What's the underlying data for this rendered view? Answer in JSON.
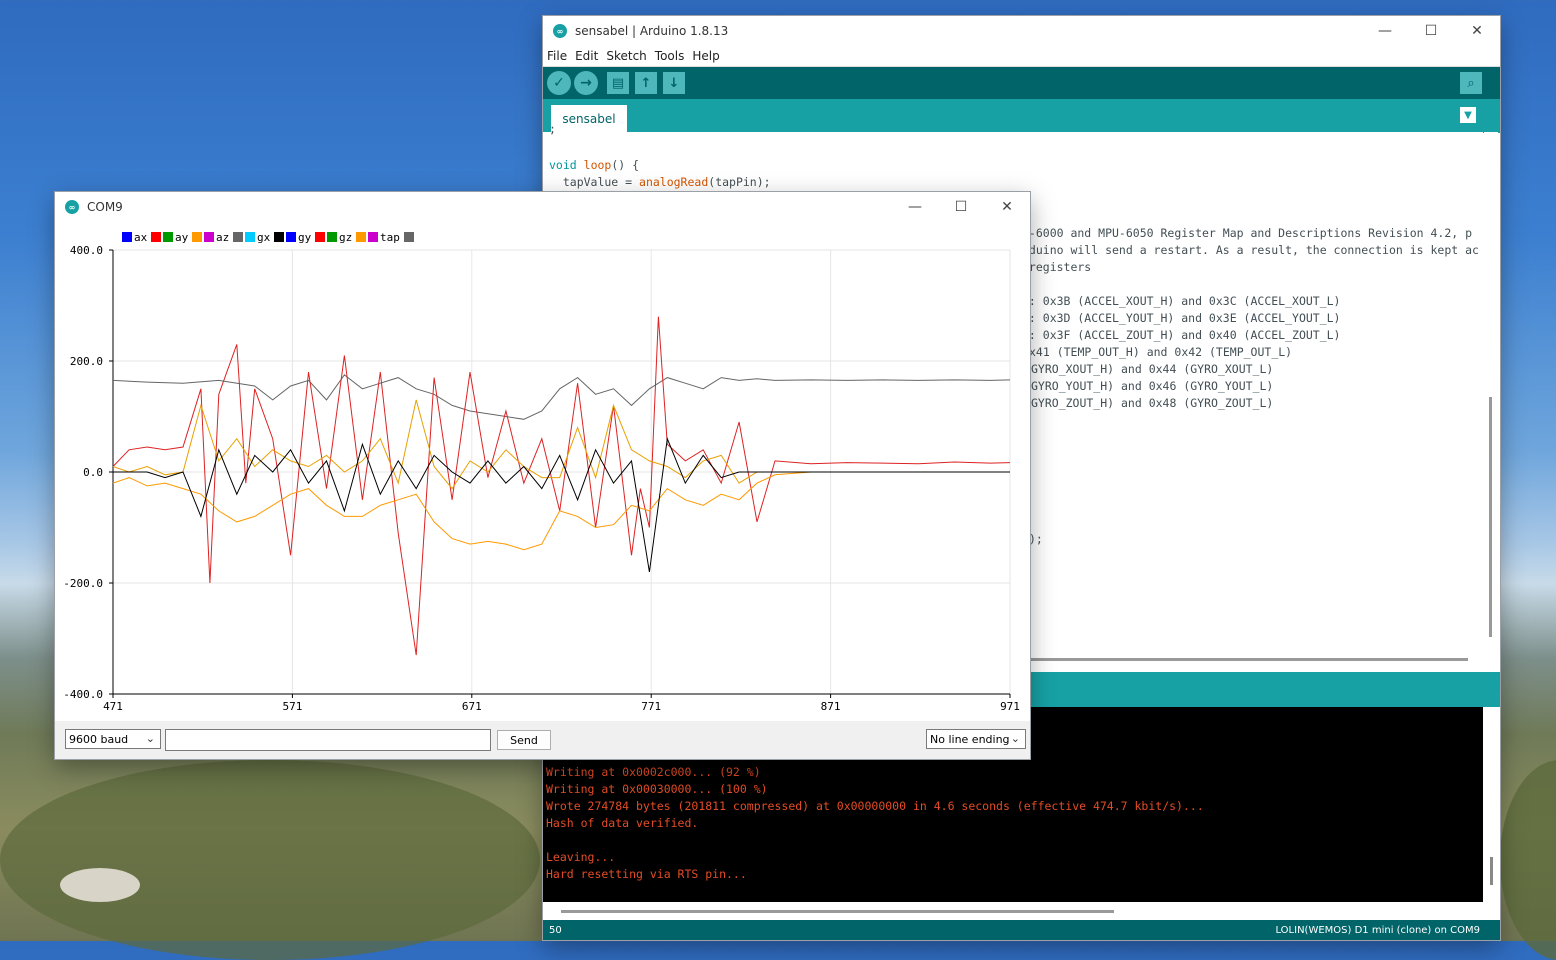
{
  "ide": {
    "title": "sensabel | Arduino 1.8.13",
    "menu": [
      "File",
      "Edit",
      "Sketch",
      "Tools",
      "Help"
    ],
    "tab": "sensabel",
    "code": {
      "l0": ";",
      "l1_kw": "void",
      "l1_fn": "loop",
      "l1_rest": "() {",
      "l2_pre": "  tapValue = ",
      "l2_fn": "analogRead",
      "l2_post": "(tapPin);",
      "c1": "U-6000 and MPU-6050 Register Map and Descriptions Revision 4.2, p",
      "c2": "rduino will send a restart. As a result, the connection is kept ac",
      "c3": " registers",
      "c4": "s: 0x3B (ACCEL_XOUT_H) and 0x3C (ACCEL_XOUT_L)",
      "c5": "s: 0x3D (ACCEL_YOUT_H) and 0x3E (ACCEL_YOUT_L)",
      "c6": "s: 0x3F (ACCEL_ZOUT_H) and 0x40 (ACCEL_ZOUT_L)",
      "c7": "x41 (TEMP_OUT_H) and 0x42 (TEMP_OUT_L)",
      "c8": "GYRO_XOUT_H) and 0x44 (GYRO_XOUT_L)",
      "c9": "GYRO_YOUT_H) and 0x46 (GYRO_YOUT_L)",
      "c10": "GYRO_ZOUT_H) and 0x48 (GYRO_ZOUT_L)",
      "c11": ");"
    },
    "console": [
      "Writing at 0x0002c000... (92 %)",
      "Writing at 0x00030000... (100 %)",
      "Wrote 274784 bytes (201811 compressed) at 0x00000000 in 4.6 seconds (effective 474.7 kbit/s)...",
      "Hash of data verified.",
      "",
      "Leaving...",
      "Hard resetting via RTS pin..."
    ],
    "status_line": "50",
    "status_board": "LOLIN(WEMOS) D1 mini (clone) on COM9"
  },
  "plotter": {
    "title": "COM9",
    "baud": "9600 baud",
    "send_label": "Send",
    "line_ending": "No line ending"
  },
  "chart_data": {
    "type": "line",
    "legend": [
      {
        "name": "ax",
        "color": "#0000ff"
      },
      {
        "name": "ay",
        "color": "#ff0000"
      },
      {
        "name": "az",
        "color": "#009900"
      },
      {
        "name": "gx",
        "color": "#ff9900"
      },
      {
        "name": "gy",
        "color": "#cc00cc"
      },
      {
        "name": "gz",
        "color": "#666666"
      },
      {
        "name": "tap",
        "color": "#00ccff"
      }
    ],
    "legend_swatches": [
      "#0000ff",
      "#ff0000",
      "#009900",
      "#ff9900",
      "#cc00cc",
      "#666666",
      "#00ccff",
      "#000000",
      "#0000ff",
      "#ff0000",
      "#009900",
      "#ff9900",
      "#cc00cc",
      "#666666"
    ],
    "xlim": [
      471,
      971
    ],
    "ylim": [
      -400,
      400
    ],
    "xticks": [
      471,
      571,
      671,
      771,
      871,
      971
    ],
    "yticks": [
      400,
      200,
      0,
      -200,
      -400
    ],
    "ytick_labels": [
      "400.0",
      "200.0",
      "0.0",
      "-200.0",
      "-400.0"
    ],
    "grid": true,
    "series": [
      {
        "color": "#666666",
        "x": [
          471,
          490,
          510,
          530,
          550,
          560,
          570,
          580,
          590,
          600,
          610,
          620,
          630,
          640,
          650,
          660,
          670,
          680,
          690,
          700,
          710,
          720,
          730,
          740,
          750,
          760,
          770,
          780,
          790,
          800,
          810,
          820,
          830,
          840,
          860,
          880,
          900,
          920,
          940,
          960,
          971
        ],
        "y": [
          165,
          162,
          160,
          165,
          155,
          130,
          155,
          165,
          130,
          175,
          150,
          160,
          170,
          150,
          140,
          120,
          110,
          105,
          100,
          95,
          110,
          150,
          170,
          140,
          150,
          120,
          150,
          170,
          160,
          150,
          170,
          165,
          168,
          165,
          166,
          165,
          166,
          165,
          166,
          165,
          166
        ]
      },
      {
        "color": "#dd2222",
        "x": [
          471,
          480,
          490,
          500,
          510,
          520,
          525,
          530,
          540,
          545,
          550,
          560,
          570,
          580,
          590,
          600,
          610,
          620,
          630,
          640,
          650,
          660,
          670,
          680,
          690,
          700,
          710,
          720,
          730,
          740,
          750,
          760,
          765,
          770,
          775,
          780,
          790,
          800,
          810,
          820,
          830,
          840,
          860,
          880,
          900,
          920,
          940,
          960,
          971
        ],
        "y": [
          10,
          40,
          45,
          40,
          45,
          150,
          -200,
          140,
          230,
          -20,
          150,
          60,
          -150,
          180,
          -30,
          210,
          -50,
          180,
          -110,
          -330,
          170,
          -50,
          180,
          -10,
          110,
          -20,
          60,
          -70,
          160,
          -100,
          120,
          -150,
          -30,
          -100,
          280,
          50,
          20,
          40,
          -20,
          90,
          -90,
          20,
          15,
          17,
          16,
          15,
          18,
          16,
          17
        ]
      },
      {
        "color": "#ff9900",
        "x": [
          471,
          480,
          490,
          500,
          510,
          520,
          530,
          540,
          550,
          560,
          570,
          580,
          590,
          600,
          610,
          620,
          630,
          640,
          650,
          660,
          670,
          680,
          690,
          700,
          710,
          720,
          730,
          740,
          750,
          760,
          770,
          780,
          790,
          800,
          810,
          820,
          830,
          840,
          860,
          900,
          971
        ],
        "y": [
          -20,
          -10,
          -25,
          -20,
          -30,
          -40,
          -70,
          -90,
          -80,
          -60,
          -40,
          -30,
          -60,
          -80,
          -80,
          -60,
          -50,
          -40,
          -90,
          -120,
          -130,
          -125,
          -130,
          -140,
          -130,
          -70,
          -80,
          -100,
          -95,
          -60,
          -70,
          -30,
          -50,
          -60,
          -40,
          -50,
          -20,
          -5,
          0,
          0,
          0
        ]
      },
      {
        "color": "#e8a000",
        "x": [
          471,
          480,
          490,
          500,
          510,
          520,
          530,
          540,
          550,
          560,
          570,
          580,
          590,
          600,
          610,
          620,
          630,
          640,
          650,
          660,
          670,
          680,
          690,
          700,
          710,
          720,
          730,
          740,
          750,
          760,
          770,
          780,
          790,
          800,
          810,
          820,
          830,
          840,
          860,
          900,
          971
        ],
        "y": [
          10,
          0,
          10,
          -5,
          0,
          120,
          20,
          60,
          10,
          40,
          20,
          10,
          30,
          0,
          20,
          60,
          -20,
          130,
          10,
          -30,
          20,
          0,
          40,
          10,
          -10,
          -10,
          80,
          -10,
          120,
          40,
          20,
          10,
          -10,
          20,
          30,
          -20,
          0,
          0,
          0,
          0,
          0
        ]
      },
      {
        "color": "#000000",
        "x": [
          471,
          480,
          490,
          500,
          510,
          520,
          530,
          540,
          550,
          560,
          570,
          580,
          590,
          600,
          610,
          620,
          630,
          640,
          650,
          660,
          670,
          680,
          690,
          700,
          710,
          720,
          730,
          740,
          750,
          760,
          770,
          780,
          790,
          800,
          810,
          820,
          830,
          840,
          860,
          900,
          971
        ],
        "y": [
          0,
          0,
          0,
          -10,
          0,
          -80,
          40,
          -40,
          30,
          0,
          40,
          -20,
          20,
          -70,
          50,
          -40,
          20,
          -30,
          30,
          0,
          -20,
          20,
          -20,
          10,
          -30,
          30,
          -50,
          40,
          -20,
          20,
          -180,
          60,
          -20,
          30,
          -10,
          0,
          0,
          0,
          0,
          0,
          0
        ]
      }
    ]
  }
}
